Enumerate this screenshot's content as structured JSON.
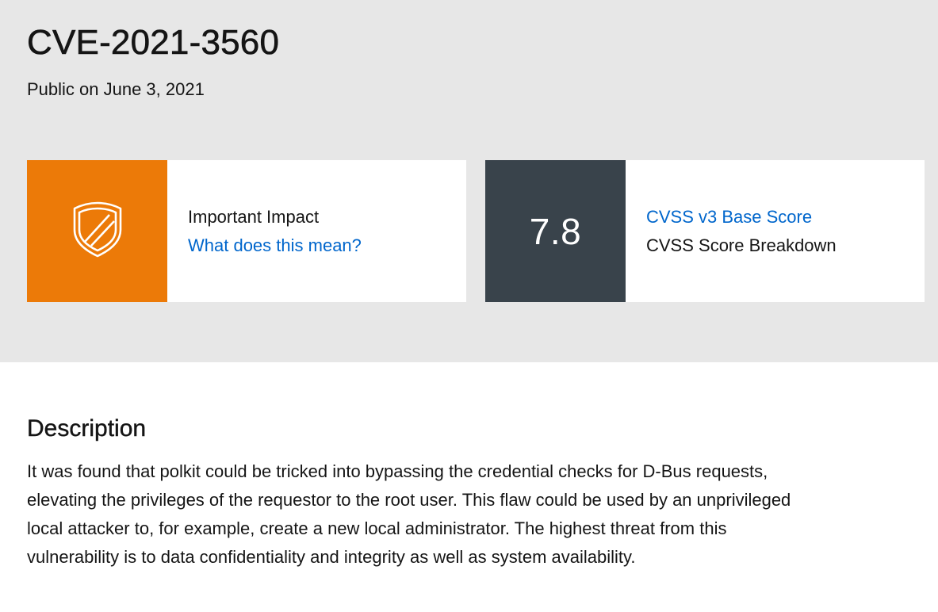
{
  "header": {
    "title": "CVE-2021-3560",
    "public_date": "Public on June 3, 2021"
  },
  "impact_card": {
    "icon": "shield-icon",
    "color": "#ec7a08",
    "label": "Important Impact",
    "link": "What does this mean?"
  },
  "score_card": {
    "color": "#39434b",
    "score": "7.8",
    "link": "CVSS v3 Base Score",
    "label": "CVSS Score Breakdown"
  },
  "description": {
    "heading": "Description",
    "body": "It was found that polkit could be tricked into bypassing the credential checks for D-Bus requests, elevating the privileges of the requestor to the root user. This flaw could be used by an unprivileged local attacker to, for example, create a new local administrator. The highest threat from this vulnerability is to data confidentiality and integrity as well as system availability."
  },
  "colors": {
    "hero_background": "#e7e7e7",
    "link": "#0066cc"
  }
}
